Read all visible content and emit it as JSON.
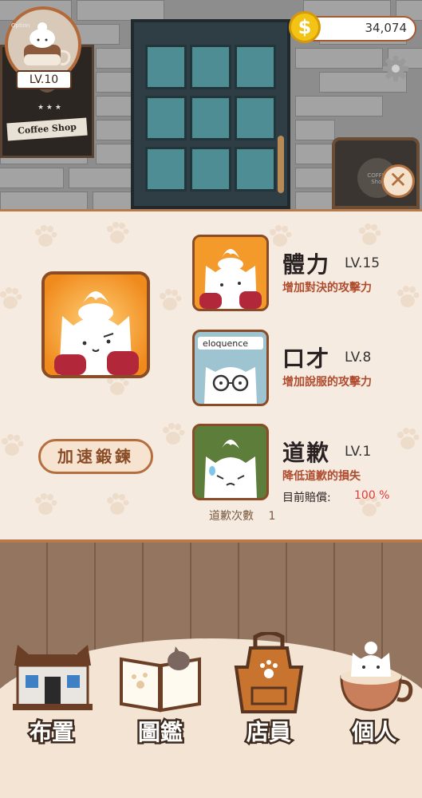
{
  "header": {
    "option_label": "Option",
    "level": "LV.10",
    "coins": "34,074",
    "sign_text": "Coffee Shop",
    "board_text": "COFFEE Shop"
  },
  "icons": {
    "coin": "$",
    "close": "✕"
  },
  "training": {
    "button_label": "加速鍛鍊"
  },
  "skills": [
    {
      "name": "體力",
      "level": "LV.15",
      "desc": "增加對決的攻擊力"
    },
    {
      "name": "口才",
      "level": "LV.8",
      "desc": "增加說服的攻擊力",
      "badge": "eloquence"
    },
    {
      "name": "道歉",
      "level": "LV.1",
      "desc": "降低道歉的損失"
    }
  ],
  "compensation": {
    "label": "目前賠償:",
    "value": "100 %"
  },
  "apology_count": {
    "label": "道歉次數",
    "value": "1"
  },
  "nav": [
    {
      "label": "布置"
    },
    {
      "label": "圖鑑"
    },
    {
      "label": "店員"
    },
    {
      "label": "個人"
    }
  ],
  "colors": {
    "accent": "#b77a4b",
    "desc": "#b04b2d",
    "percent": "#e23b3b"
  }
}
